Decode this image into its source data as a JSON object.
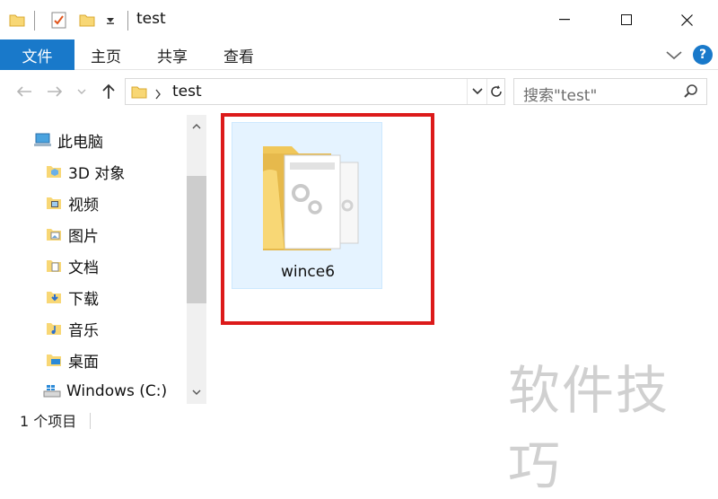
{
  "window": {
    "title": "test",
    "minimize": "—",
    "maximize": "☐",
    "close": "✕"
  },
  "ribbon": {
    "tabs": [
      "文件",
      "主页",
      "共享",
      "查看"
    ],
    "help_label": "?"
  },
  "address": {
    "path": "test",
    "search_placeholder": "搜索\"test\""
  },
  "nav_pane": {
    "items": [
      {
        "label": "此电脑",
        "icon": "pc-icon"
      },
      {
        "label": "3D 对象",
        "icon": "3d-objects-folder-icon"
      },
      {
        "label": "视频",
        "icon": "videos-folder-icon"
      },
      {
        "label": "图片",
        "icon": "pictures-folder-icon"
      },
      {
        "label": "文档",
        "icon": "documents-folder-icon"
      },
      {
        "label": "下载",
        "icon": "downloads-folder-icon"
      },
      {
        "label": "音乐",
        "icon": "music-folder-icon"
      },
      {
        "label": "桌面",
        "icon": "desktop-folder-icon"
      },
      {
        "label": "Windows (C:)",
        "icon": "drive-icon"
      }
    ]
  },
  "content": {
    "items": [
      {
        "name": "wince6",
        "icon": "settings-folder-icon",
        "selected": true
      }
    ]
  },
  "status": {
    "count": "1 个项目"
  },
  "watermark": "软件技巧",
  "colors": {
    "accent": "#1979ca",
    "selection_fill": "#e5f3ff",
    "highlight_border": "#dc1a1a",
    "folder_yellow": "#f8d775"
  }
}
